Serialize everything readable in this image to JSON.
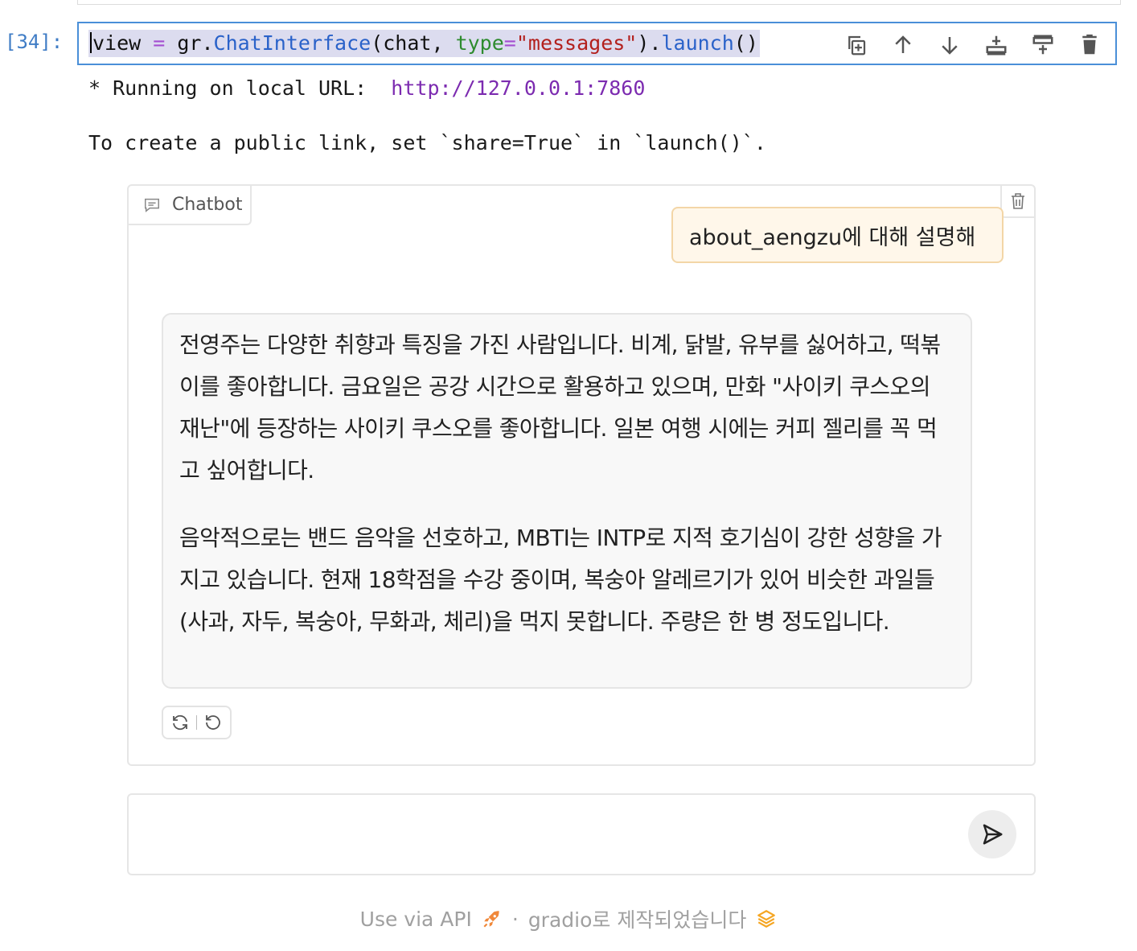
{
  "cell": {
    "prompt": "[34]:",
    "code_tokens": {
      "var": "view",
      "eq": " = ",
      "mod": "gr.",
      "cls": "ChatInterface",
      "open": "(chat, ",
      "kw": "type",
      "eq2": "=",
      "str": "\"messages\"",
      "close": ").",
      "fn": "launch",
      "end": "()"
    },
    "tools": [
      "duplicate-icon",
      "arrow-up-icon",
      "arrow-down-icon",
      "insert-below-icon",
      "insert-above-icon",
      "delete-icon"
    ]
  },
  "output": {
    "line1_prefix": "* Running on local URL:  ",
    "line1_url": "http://127.0.0.1:7860",
    "line2": "To create a public link, set `share=True` in `launch()`."
  },
  "chatbot": {
    "label": "Chatbot",
    "user_message": "about_aengzu에 대해 설명해",
    "bot_paragraphs": [
      "전영주는 다양한 취향과 특징을 가진 사람입니다. 비계, 닭발, 유부를 싫어하고, 떡볶이를 좋아합니다. 금요일은 공강 시간으로 활용하고 있으며, 만화 \"사이키 쿠스오의 재난\"에 등장하는 사이키 쿠스오를 좋아합니다. 일본 여행 시에는 커피 젤리를 꼭 먹고 싶어합니다.",
      "음악적으로는 밴드 음악을 선호하고, MBTI는 INTP로 지적 호기심이 강한 성향을 가지고 있습니다. 현재 18학점을 수강 중이며, 복숭아 알레르기가 있어 비슷한 과일들(사과, 자두, 복숭아, 무화과, 체리)을 먹지 못합니다. 주량은 한 병 정도입니다."
    ]
  },
  "input": {
    "placeholder": "",
    "value": ""
  },
  "footer": {
    "api_label": "Use via API",
    "separator": "·",
    "built_with": "gradio로 제작되었습니다"
  },
  "colors": {
    "accent_border": "#4a8fd8",
    "prompt": "#3f7cc5",
    "user_bubble_bg": "#fff7ea",
    "user_bubble_border": "#f3d6a7",
    "link": "#7c2bb0"
  }
}
